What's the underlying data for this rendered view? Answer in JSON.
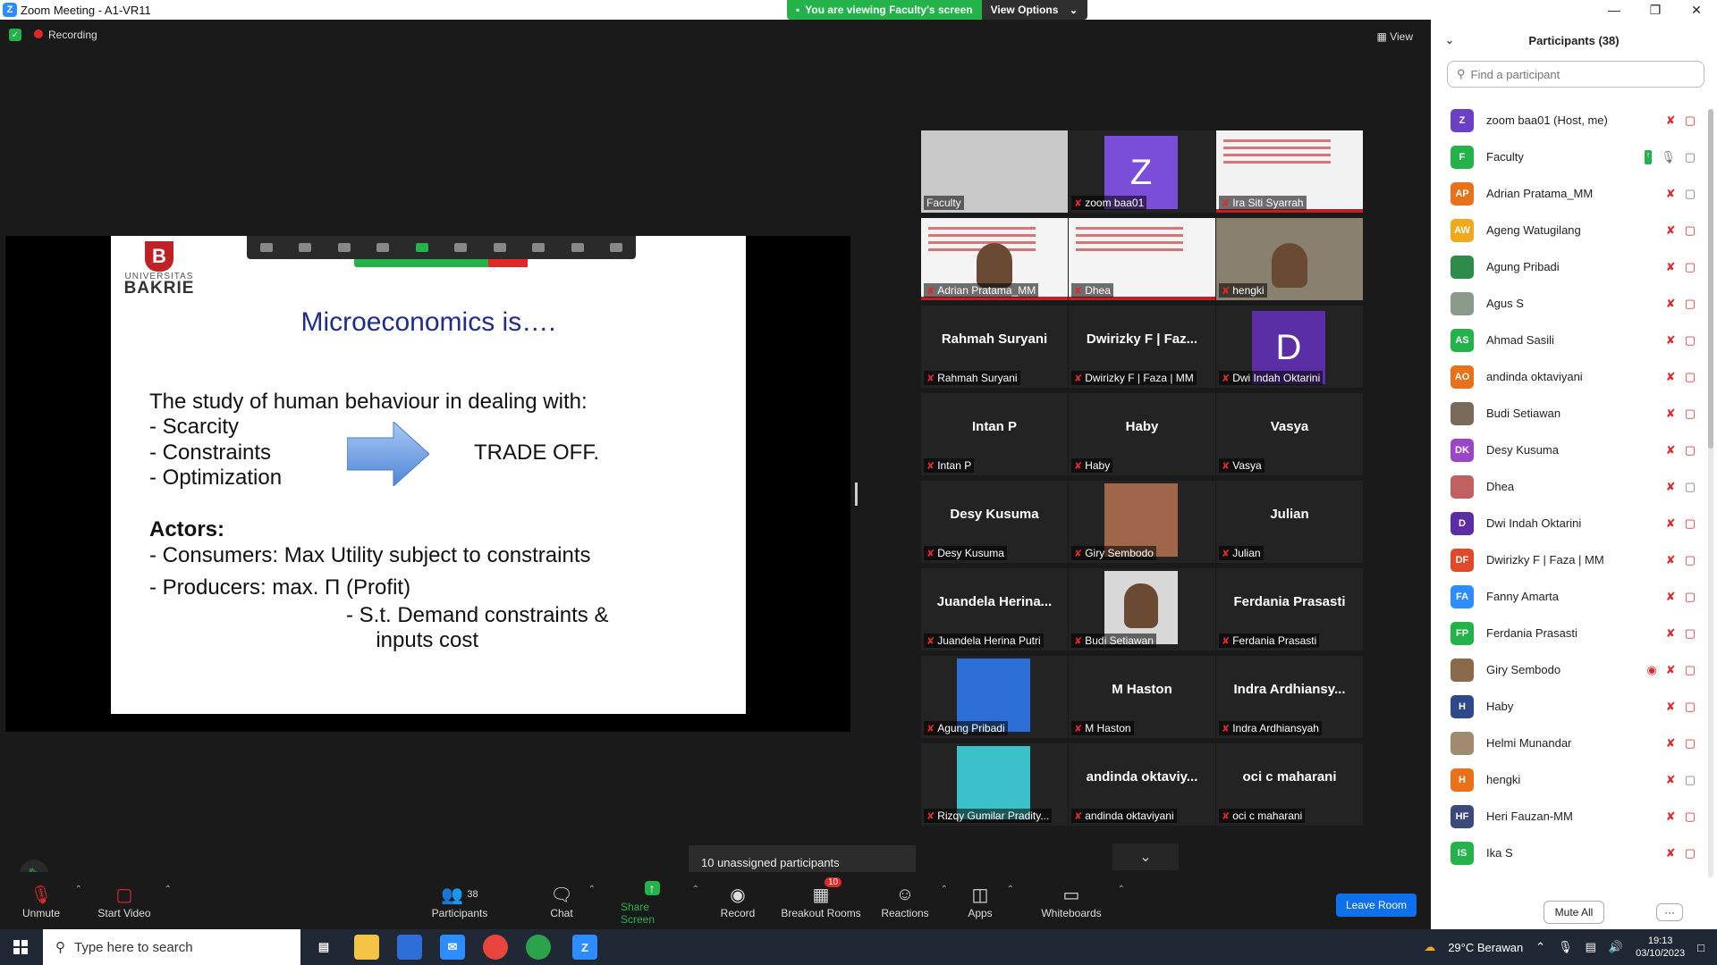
{
  "window": {
    "title": "Zoom Meeting - A1-VR11"
  },
  "share_banner": {
    "status": "You are viewing Faculty's screen",
    "view_options": "View Options"
  },
  "meeting_info": {
    "recording": "Recording",
    "view": "View"
  },
  "slide": {
    "logo_letter": "B",
    "logo_university": "UNIVERSITAS",
    "logo_name": "BAKRIE",
    "title": "Microeconomics is….",
    "line1": "The study of human behaviour in dealing with:",
    "bullet1": "-   Scarcity",
    "bullet2": "-   Constraints",
    "bullet3": "-   Optimization",
    "trade_off": "TRADE OFF.",
    "actors": "Actors:",
    "consumers": "- Consumers: Max Utility subject to constraints",
    "producers": "-   Producers: max. Π (Profit)",
    "st1": "-   S.t. Demand constraints &",
    "st2": "     inputs cost"
  },
  "gallery": {
    "tiles": [
      {
        "label": "Faculty",
        "big": ""
      },
      {
        "label": "zoom baa01",
        "big": "Z"
      },
      {
        "label": "Ira Siti Syarrah",
        "big": ""
      },
      {
        "label": "Adrian Pratama_MM",
        "big": ""
      },
      {
        "label": "Dhea",
        "big": ""
      },
      {
        "label": "hengki",
        "big": ""
      },
      {
        "label": "Rahmah Suryani",
        "big": "Rahmah Suryani"
      },
      {
        "label": "Dwirizky F | Faza | MM",
        "big": "Dwirizky F | Faz..."
      },
      {
        "label": "Dwi Indah Oktarini",
        "big": "D"
      },
      {
        "label": "Intan P",
        "big": "Intan P"
      },
      {
        "label": "Haby",
        "big": "Haby"
      },
      {
        "label": "Vasya",
        "big": "Vasya"
      },
      {
        "label": "Desy Kusuma",
        "big": "Desy Kusuma"
      },
      {
        "label": "Giry Sembodo",
        "big": ""
      },
      {
        "label": "Julian",
        "big": "Julian"
      },
      {
        "label": "Juandela Herina Putri",
        "big": "Juandela Herina..."
      },
      {
        "label": "Budi Setiawan",
        "big": ""
      },
      {
        "label": "Ferdania Prasasti",
        "big": "Ferdania Prasasti"
      },
      {
        "label": "Agung Pribadi",
        "big": ""
      },
      {
        "label": "M Haston",
        "big": "M Haston"
      },
      {
        "label": "Indra Ardhiansyah",
        "big": "Indra  Ardhiansy..."
      },
      {
        "label": "Rizqy Gumilar Pradity...",
        "big": ""
      },
      {
        "label": "andinda oktaviyani",
        "big": "andinda  oktaviy..."
      },
      {
        "label": "oci c maharani",
        "big": "oci c maharani"
      }
    ]
  },
  "unassigned": "10 unassigned participants",
  "toolbar": {
    "unmute": "Unmute",
    "start_video": "Start Video",
    "participants": "Participants",
    "participants_count": "38",
    "chat": "Chat",
    "share_screen": "Share Screen",
    "record": "Record",
    "breakout_rooms": "Breakout Rooms",
    "breakout_badge": "10",
    "reactions": "Reactions",
    "apps": "Apps",
    "whiteboards": "Whiteboards",
    "leave_room": "Leave Room"
  },
  "panel": {
    "title": "Participants (38)",
    "search_placeholder": "Find a participant",
    "mute_all": "Mute All",
    "more": "···",
    "participants": [
      {
        "name": "zoom baa01 (Host, me)",
        "initials": "Z",
        "color": "#6c3fc4"
      },
      {
        "name": "Faculty",
        "initials": "F",
        "color": "#23b34a"
      },
      {
        "name": "Adrian Pratama_MM",
        "initials": "AP",
        "color": "#e8711a"
      },
      {
        "name": "Ageng Watugilang",
        "initials": "AW",
        "color": "#f0a81d"
      },
      {
        "name": "Agung Pribadi",
        "initials": "",
        "color": "#2d8c4a"
      },
      {
        "name": "Agus S",
        "initials": "",
        "color": "#8a9b8a"
      },
      {
        "name": "Ahmad Sasili",
        "initials": "AS",
        "color": "#23b34a"
      },
      {
        "name": "andinda oktaviyani",
        "initials": "AO",
        "color": "#e8711a"
      },
      {
        "name": "Budi Setiawan",
        "initials": "",
        "color": "#7a6a5a"
      },
      {
        "name": "Desy Kusuma",
        "initials": "DK",
        "color": "#9b45c7"
      },
      {
        "name": "Dhea",
        "initials": "",
        "color": "#c06060"
      },
      {
        "name": "Dwi Indah Oktarini",
        "initials": "D",
        "color": "#5b2ea6"
      },
      {
        "name": "Dwirizky F | Faza | MM",
        "initials": "DF",
        "color": "#e04a2a"
      },
      {
        "name": "Fanny Amarta",
        "initials": "FA",
        "color": "#2d8cff"
      },
      {
        "name": "Ferdania Prasasti",
        "initials": "FP",
        "color": "#23b34a"
      },
      {
        "name": "Giry Sembodo",
        "initials": "",
        "color": "#8a6a4a"
      },
      {
        "name": "Haby",
        "initials": "H",
        "color": "#2e4a8a"
      },
      {
        "name": "Helmi Munandar",
        "initials": "",
        "color": "#a08a70"
      },
      {
        "name": "hengki",
        "initials": "H",
        "color": "#e8711a"
      },
      {
        "name": "Heri Fauzan-MM",
        "initials": "HF",
        "color": "#3a4a7a"
      },
      {
        "name": "Ika S",
        "initials": "IS",
        "color": "#23b34a"
      }
    ]
  },
  "taskbar": {
    "search": "Type here to search",
    "weather": "29°C  Berawan",
    "time": "19:13",
    "date": "03/10/2023"
  }
}
